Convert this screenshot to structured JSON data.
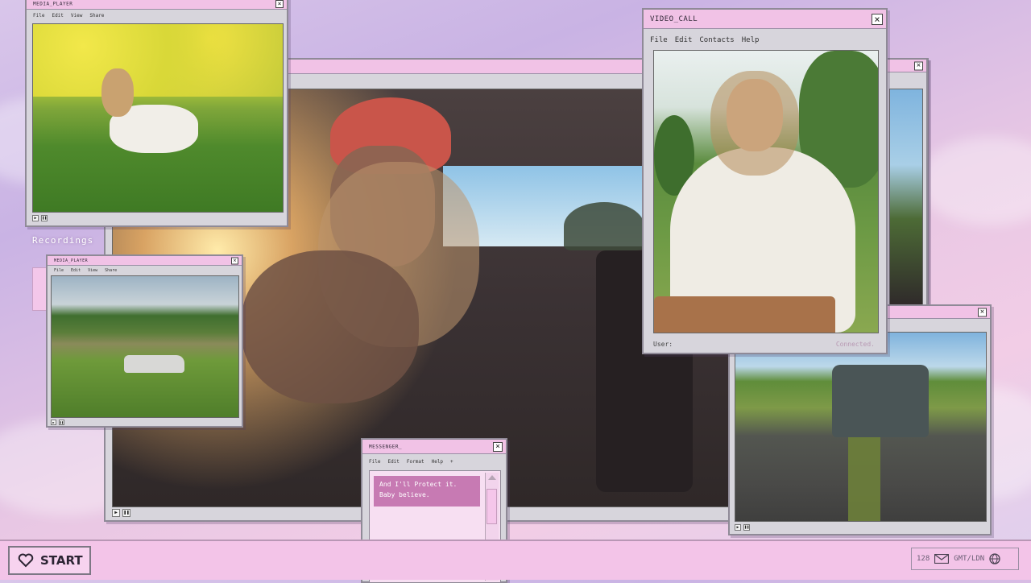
{
  "desktop": {
    "recordings_label": "Recordings"
  },
  "menus": {
    "media": [
      "File",
      "Edit",
      "View",
      "Share"
    ],
    "video_call": [
      "File",
      "Edit",
      "Contacts",
      "Help"
    ],
    "messenger": [
      "File",
      "Edit",
      "Format",
      "Help",
      "+"
    ]
  },
  "media_player_top": {
    "title": "MEDIA_PLAYER",
    "close": "×"
  },
  "media_player_small": {
    "title": "MEDIA_PLAYER",
    "close": "×"
  },
  "main_window": {
    "close": "×"
  },
  "right_window": {
    "close": "×"
  },
  "video_call": {
    "title": "VIDEO_CALL",
    "close": "×",
    "user_label": "User:",
    "status": "Connected."
  },
  "messenger": {
    "title": "MESSENGER_",
    "close": "×",
    "message": "And I'll Protect it. Baby believe."
  },
  "controls": {
    "play": "▶",
    "pause": "❚❚"
  },
  "taskbar": {
    "start_label": "START",
    "tray_count": "128",
    "tray_clock": "GMT/LDN"
  },
  "icons": {
    "start": "heart-icon",
    "tray_mail": "mail-icon",
    "tray_globe": "globe-icon"
  },
  "colors": {
    "titlebar": "#f1c2e6",
    "taskbar": "#f3c4e8",
    "message_bubble": "#c77ab3",
    "window_frame": "#d7d5dc"
  }
}
